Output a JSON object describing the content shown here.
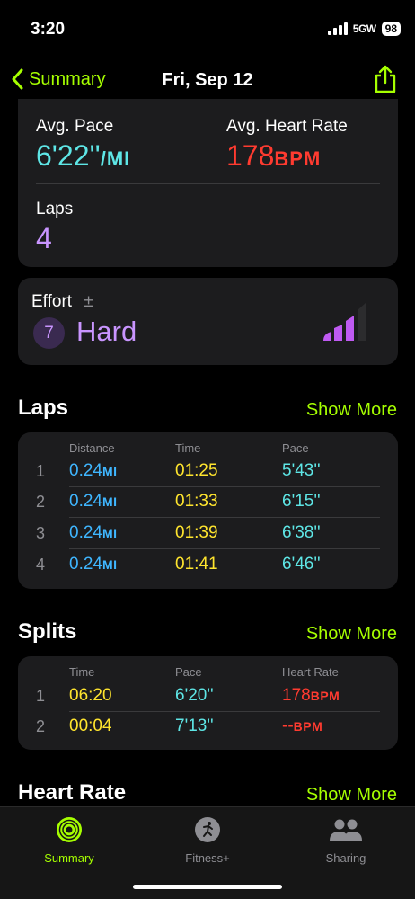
{
  "status": {
    "time": "3:20",
    "network": "5GW",
    "battery": "98"
  },
  "nav": {
    "back_label": "Summary",
    "title": "Fri, Sep 12"
  },
  "summary": {
    "avg_pace_label": "Avg. Pace",
    "avg_pace_value": "6'22''",
    "avg_pace_unit": "/MI",
    "avg_hr_label": "Avg. Heart Rate",
    "avg_hr_value": "178",
    "avg_hr_unit": "BPM",
    "laps_label": "Laps",
    "laps_value": "4"
  },
  "effort": {
    "label": "Effort",
    "info_symbol": "±",
    "score": "7",
    "level": "Hard",
    "bars_filled": 3,
    "bars_total": 4
  },
  "laps": {
    "title": "Laps",
    "show_more": "Show More",
    "headers": [
      "Distance",
      "Time",
      "Pace"
    ],
    "unit": "MI",
    "rows": [
      {
        "index": "1",
        "distance": "0.24",
        "time": "01:25",
        "pace": "5'43''"
      },
      {
        "index": "2",
        "distance": "0.24",
        "time": "01:33",
        "pace": "6'15''"
      },
      {
        "index": "3",
        "distance": "0.24",
        "time": "01:39",
        "pace": "6'38''"
      },
      {
        "index": "4",
        "distance": "0.24",
        "time": "01:41",
        "pace": "6'46''"
      }
    ]
  },
  "splits": {
    "title": "Splits",
    "show_more": "Show More",
    "headers": [
      "Time",
      "Pace",
      "Heart Rate"
    ],
    "unit": "BPM",
    "rows": [
      {
        "index": "1",
        "time": "06:20",
        "pace": "6'20''",
        "hr": "178"
      },
      {
        "index": "2",
        "time": "00:04",
        "pace": "7'13''",
        "hr": "--"
      }
    ]
  },
  "heart_rate": {
    "title": "Heart Rate",
    "show_more": "Show More"
  },
  "tabs": [
    {
      "label": "Summary",
      "icon": "activity-rings-icon",
      "active": true
    },
    {
      "label": "Fitness+",
      "icon": "running-person-icon",
      "active": false
    },
    {
      "label": "Sharing",
      "icon": "people-icon",
      "active": false
    }
  ],
  "colors": {
    "accent": "#a6ff00",
    "pace": "#5ee6e6",
    "heart_rate": "#ff3b30",
    "distance": "#3fb6ff",
    "time": "#ffe52e",
    "effort": "#c995ff"
  }
}
